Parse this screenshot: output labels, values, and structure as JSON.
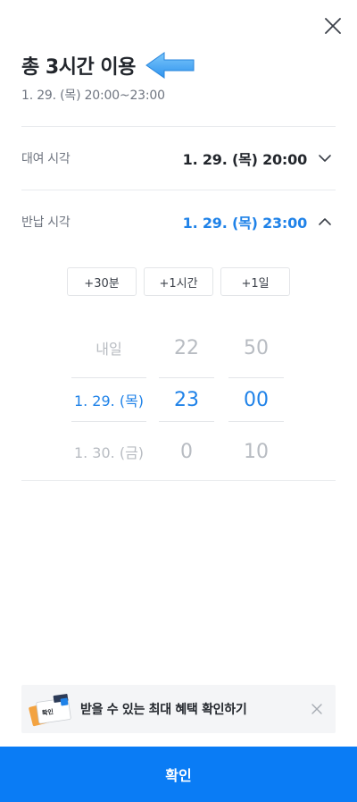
{
  "header": {
    "title": "총 3시간 이용",
    "subtitle": "1. 29. (목) 20:00~23:00",
    "close_icon": "close-icon",
    "arrow_icon": "arrow-left-icon",
    "arrow_color": "#4aaaf2"
  },
  "rental": {
    "label": "대여 시각",
    "value": "1. 29. (목) 20:00",
    "chevron_icon": "chevron-down-icon"
  },
  "return": {
    "label": "반납 시각",
    "value": "1. 29. (목) 23:00",
    "chevron_icon": "chevron-up-icon"
  },
  "quick_add": [
    "+30분",
    "+1시간",
    "+1일"
  ],
  "picker": {
    "dates": [
      "내일",
      "1. 29. (목)",
      "1. 30. (금)"
    ],
    "hours": [
      "22",
      "23",
      "0"
    ],
    "minutes": [
      "50",
      "00",
      "10"
    ],
    "selected_index": 1
  },
  "banner": {
    "text": "받을 수 있는 최대 혜택 확인하기",
    "image_icon": "coupon-cards-icon",
    "image_label": "확인",
    "close_icon": "close-icon"
  },
  "confirm_label": "확인",
  "colors": {
    "accent": "#1f82e8",
    "button": "#0a7cf5",
    "dim_text": "#b8bcc2",
    "label_text": "#6f7580"
  }
}
